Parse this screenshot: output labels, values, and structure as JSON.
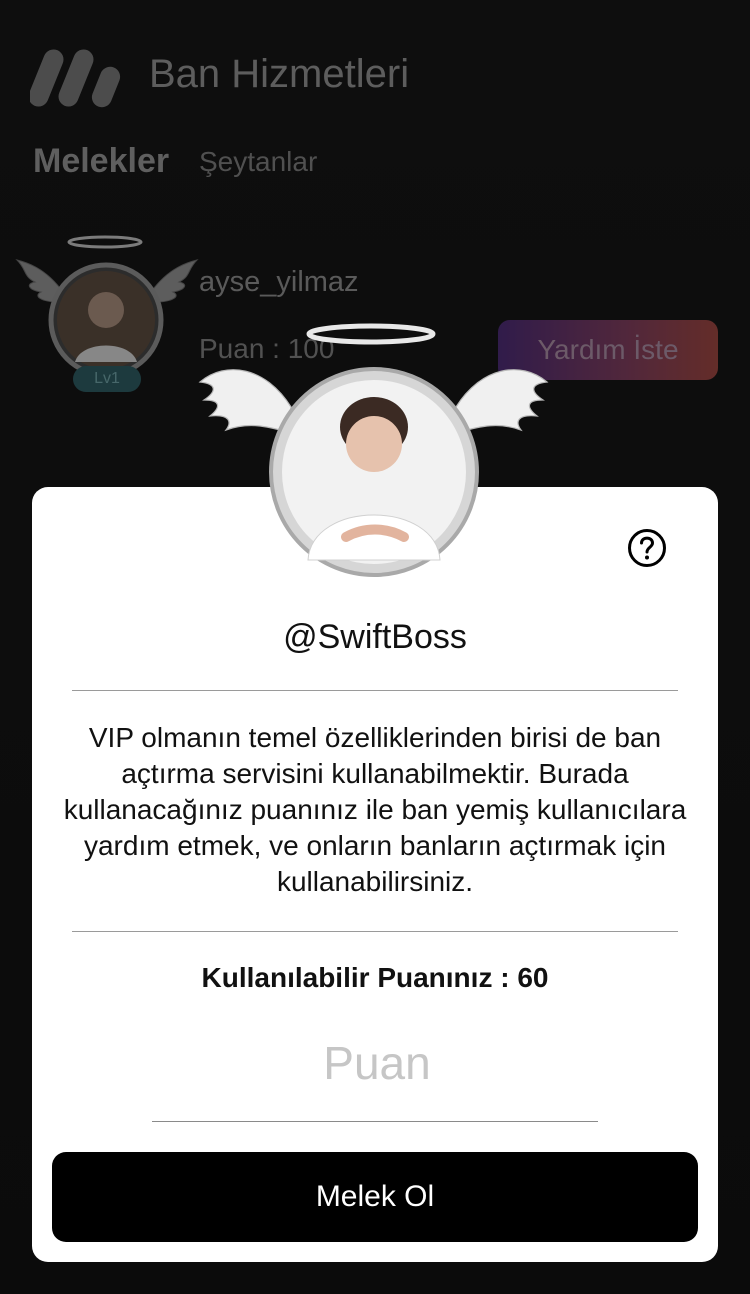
{
  "app": {
    "title": "Ban Hizmetleri"
  },
  "tabs": [
    {
      "label": "Melekler"
    },
    {
      "label": "Şeytanlar"
    }
  ],
  "list": {
    "items": [
      {
        "username": "ayse_yilmaz",
        "points_text": "Puan : 100",
        "level": "Lv1",
        "action_label": "Yardım İste"
      }
    ]
  },
  "modal": {
    "username": "@SwiftBoss",
    "description": "VIP olmanın temel özelliklerinden birisi de ban açtırma servisini kullanabilmektir. Burada kullanacağınız puanınız ile ban yemiş kullanıcılara yardım etmek, ve onların banların açtırmak için kullanabilirsiniz.",
    "available_points": "Kullanılabilir Puanınız : 60",
    "points_placeholder": "Puan",
    "submit_label": "Melek Ol"
  },
  "colors": {
    "accent_start": "#4b2b73",
    "accent_end": "#9a453f",
    "level_badge": "#2d5a60",
    "primary_button": "#000000"
  },
  "icons": [
    "app-logo-icon",
    "angel-wings-icon",
    "halo-icon",
    "question-icon"
  ]
}
